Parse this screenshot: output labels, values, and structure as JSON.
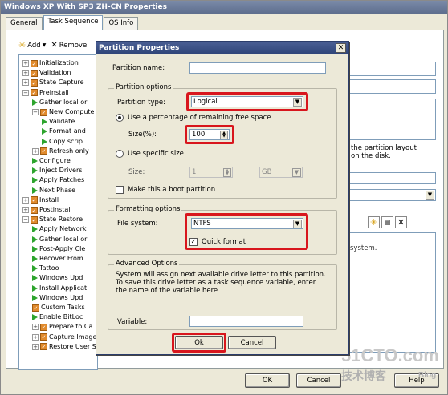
{
  "window": {
    "title": "Windows XP With SP3 ZH-CN Properties"
  },
  "tabs": [
    "General",
    "Task Sequence",
    "OS Info"
  ],
  "toolbar": {
    "add": "Add",
    "remove": "Remove"
  },
  "tree": [
    {
      "label": "Initialization",
      "indent": 0,
      "kind": "folder",
      "expander": "+"
    },
    {
      "label": "Validation",
      "indent": 0,
      "kind": "folder",
      "expander": "+"
    },
    {
      "label": "State Capture",
      "indent": 0,
      "kind": "folder",
      "expander": "+"
    },
    {
      "label": "Preinstall",
      "indent": 0,
      "kind": "folder",
      "expander": "−"
    },
    {
      "label": "Gather local or",
      "indent": 1,
      "kind": "step"
    },
    {
      "label": "New Compute",
      "indent": 1,
      "kind": "folder",
      "expander": "−"
    },
    {
      "label": "Validate",
      "indent": 2,
      "kind": "step"
    },
    {
      "label": "Format and",
      "indent": 2,
      "kind": "step"
    },
    {
      "label": "Copy scrip",
      "indent": 2,
      "kind": "step"
    },
    {
      "label": "Refresh only",
      "indent": 1,
      "kind": "folder",
      "expander": "+"
    },
    {
      "label": "Configure",
      "indent": 1,
      "kind": "step"
    },
    {
      "label": "Inject Drivers",
      "indent": 1,
      "kind": "step"
    },
    {
      "label": "Apply Patches",
      "indent": 1,
      "kind": "step"
    },
    {
      "label": "Next Phase",
      "indent": 1,
      "kind": "step"
    },
    {
      "label": "Install",
      "indent": 0,
      "kind": "folder",
      "expander": "+"
    },
    {
      "label": "Postinstall",
      "indent": 0,
      "kind": "folder",
      "expander": "+"
    },
    {
      "label": "State Restore",
      "indent": 0,
      "kind": "folder",
      "expander": "−"
    },
    {
      "label": "Apply Network",
      "indent": 1,
      "kind": "step"
    },
    {
      "label": "Gather local or",
      "indent": 1,
      "kind": "step"
    },
    {
      "label": "Post-Apply Cle",
      "indent": 1,
      "kind": "step"
    },
    {
      "label": "Recover From",
      "indent": 1,
      "kind": "step"
    },
    {
      "label": "Tattoo",
      "indent": 1,
      "kind": "step"
    },
    {
      "label": "Windows Upd",
      "indent": 1,
      "kind": "step"
    },
    {
      "label": "Install Applicat",
      "indent": 1,
      "kind": "step"
    },
    {
      "label": "Windows Upd",
      "indent": 1,
      "kind": "step"
    },
    {
      "label": "Custom Tasks",
      "indent": 1,
      "kind": "checkstep"
    },
    {
      "label": "Enable BitLoc",
      "indent": 1,
      "kind": "step"
    },
    {
      "label": "Prepare to Ca",
      "indent": 1,
      "kind": "folder",
      "expander": "+"
    },
    {
      "label": "Capture Image",
      "indent": 1,
      "kind": "folder",
      "expander": "+"
    },
    {
      "label": "Restore User S",
      "indent": 1,
      "kind": "folder",
      "expander": "+"
    }
  ],
  "right_panel": {
    "text_line1": "the partition layout",
    "text_line2": "on the disk.",
    "text_line3": "system."
  },
  "dialog": {
    "title": "Partition Properties",
    "partition_name_label": "Partition name:",
    "partition_name_value": "",
    "partition_options_title": "Partition options",
    "partition_type_label": "Partition type:",
    "partition_type_value": "Logical",
    "use_percentage_label": "Use a percentage of remaining free space",
    "size_pct_label": "Size(%):",
    "size_pct_value": "100",
    "use_specific_label": "Use specific size",
    "size_label": "Size:",
    "size_value": "1",
    "size_unit": "GB",
    "boot_label": "Make this a boot partition",
    "formatting_title": "Formatting options",
    "fs_label": "File system:",
    "fs_value": "NTFS",
    "quick_format_label": "Quick format",
    "advanced_title": "Advanced Options",
    "advanced_text": "System will assign next available drive letter to this partition. To save this drive letter as a task sequence variable, enter the name of the variable here",
    "variable_label": "Variable:",
    "variable_value": "",
    "ok": "Ok",
    "cancel": "Cancel"
  },
  "footer": {
    "ok": "OK",
    "cancel": "Cancel",
    "help": "Help"
  },
  "watermark": {
    "site": "51CTO.com",
    "sub": "技术博客",
    "blog": "Blog"
  },
  "colors": {
    "highlight": "#d8161d",
    "titlebar": "#2e4478",
    "green_step": "#2da42d",
    "folder_check": "#e08a2c"
  }
}
